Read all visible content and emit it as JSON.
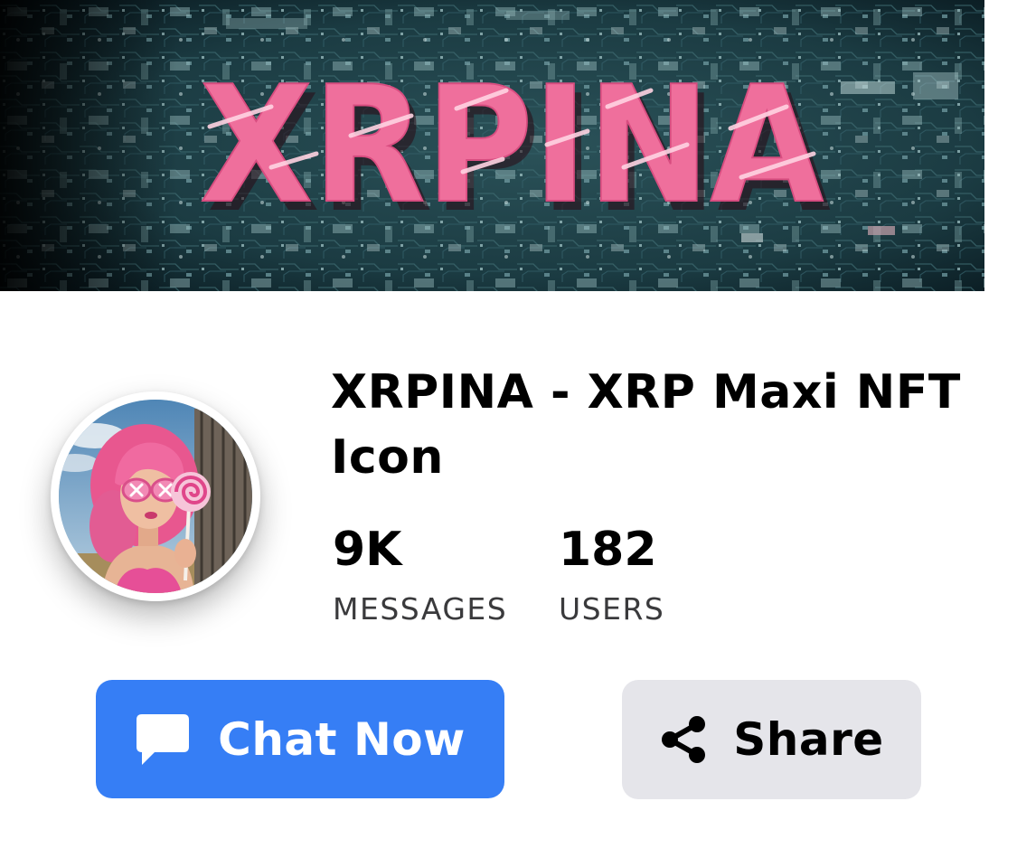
{
  "banner": {
    "text": "XRPINA"
  },
  "avatar": {
    "icon": "profile-avatar-pink-hair-girl"
  },
  "group": {
    "title": "XRPINA - XRP Maxi NFT Icon"
  },
  "stats": {
    "messages": {
      "value": "9K",
      "label": "MESSAGES"
    },
    "users": {
      "value": "182",
      "label": "USERS"
    }
  },
  "actions": {
    "chat": {
      "label": "Chat Now",
      "icon": "chat-bubble-icon"
    },
    "share": {
      "label": "Share",
      "icon": "share-icon"
    }
  },
  "colors": {
    "accent": "#367ef5",
    "share_bg": "#e5e5ea",
    "banner_text": "#ef6f9c"
  }
}
